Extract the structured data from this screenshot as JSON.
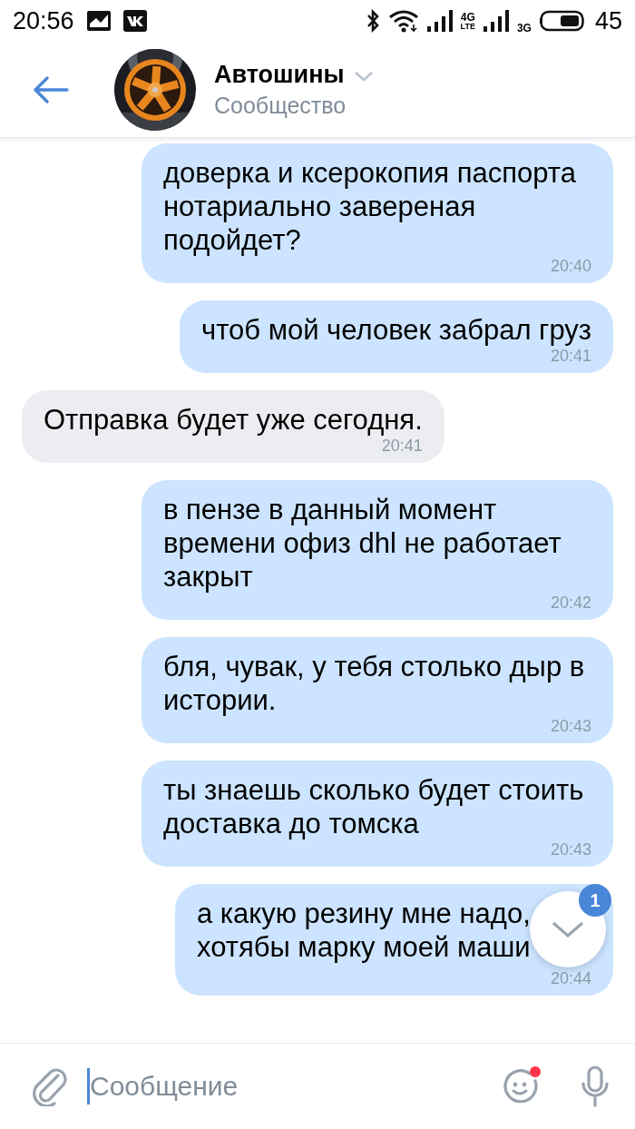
{
  "status_bar": {
    "time": "20:56",
    "network_labels": [
      "4G",
      "LTE",
      "3G"
    ],
    "battery": "45"
  },
  "header": {
    "title": "Автошины",
    "subtitle": "Сообщество"
  },
  "messages": [
    {
      "kind": "outgoing",
      "text": "доверка и ксерокопия паспорта нотариально завереная подойдет?",
      "time": "20:40"
    },
    {
      "kind": "outgoing",
      "text": "чтоб мой человек забрал груз",
      "time": "20:41"
    },
    {
      "kind": "incoming",
      "text": "Отправка будет уже сегодня.",
      "time": "20:41"
    },
    {
      "kind": "outgoing",
      "text": "в пензе в данный момент времени офиз dhl не работает закрыт",
      "time": "20:42"
    },
    {
      "kind": "outgoing",
      "text": "бля, чувак, у тебя столько дыр в истории.",
      "time": "20:43"
    },
    {
      "kind": "outgoing",
      "text": "ты знаешь сколько будет стоить доставка до томска",
      "time": "20:43"
    },
    {
      "kind": "outgoing",
      "text": "а какую резину мне надо,\nхотябы марку моей маши",
      "time": "20:44"
    }
  ],
  "scroll_button": {
    "badge": "1"
  },
  "composer": {
    "placeholder": "Сообщение",
    "emoji_notification": true
  }
}
